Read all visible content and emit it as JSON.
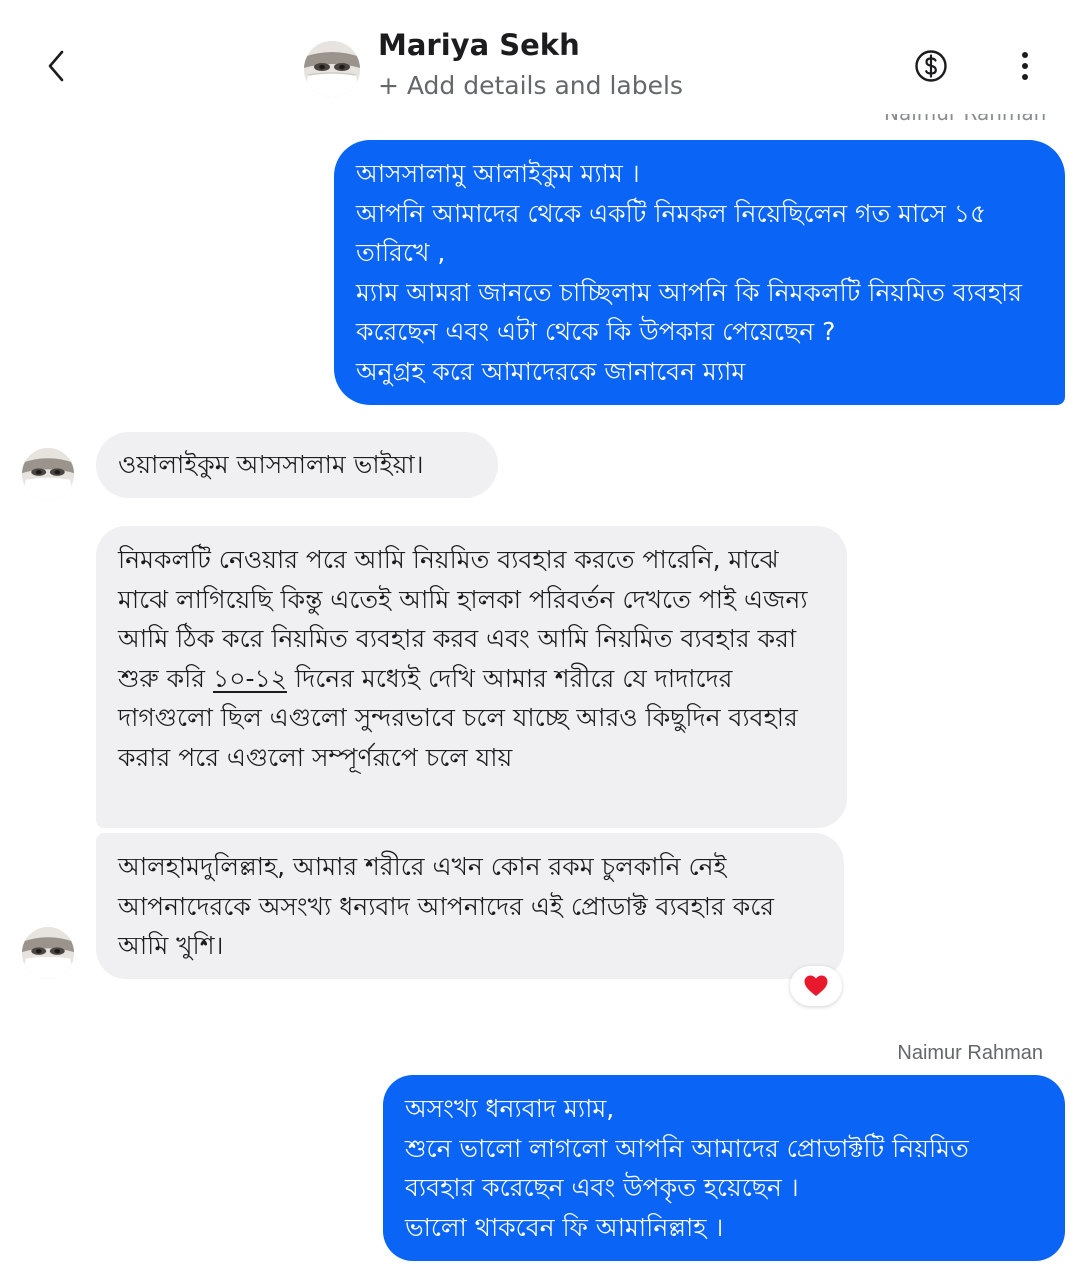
{
  "header": {
    "contact_name": "Mariya Sekh",
    "add_details": "+ Add details and labels",
    "icons": [
      "chevron-left-icon",
      "dollar-circle-icon",
      "more-vertical-icon"
    ]
  },
  "thread": {
    "clipped_sender": "Naimur Rahman",
    "messages": [
      {
        "direction": "outgoing",
        "text": "আসসালামু আলাইকুম ম্যাম ।\nআপনি আমাদের থেকে একটি নিমকল নিয়েছিলেন  গত মাসে ১৫ তারিখে ,\nম্যাম আমরা জানতে চাচ্ছিলাম আপনি কি নিমকলটি নিয়মিত ব্যবহার করেছেন এবং এটা থেকে কি উপকার পেয়েছেন ?\nঅনুগ্রহ করে আমাদেরকে জানাবেন ম্যাম"
      },
      {
        "direction": "incoming",
        "text": "ওয়ালাইকুম আসসালাম ভাইয়া।"
      },
      {
        "direction": "incoming",
        "text_before": "নিমকলটি নেওয়ার পরে আমি নিয়মিত ব্যবহার করতে পারেনি, মাঝে মাঝে লাগিয়েছি কিন্তু এতেই আমি হালকা পরিবর্তন দেখতে পাই এজন্য আমি ঠিক করে নিয়মিত ব্যবহার করব এবং আমি নিয়মিত ব্যবহার করা শুরু করি ",
        "link": "১০-১২",
        "text_after": " দিনের মধ্যেই দেখি আমার শরীরে যে দাদাদের দাগগুলো ছিল এগুলো সুন্দরভাবে চলে যাচ্ছে আরও কিছুদিন ব্যবহার করার পরে এগুলো সম্পূর্ণরূপে চলে যায়"
      },
      {
        "direction": "incoming",
        "text": "আলহামদুলিল্লাহ, আমার শরীরে এখন কোন রকম চুলকানি নেই আপনাদেরকে অসংখ্য ধন্যবাদ আপনাদের এই প্রোডাক্ট ব্যবহার করে আমি খুশি।",
        "reaction": "heart"
      },
      {
        "direction": "outgoing",
        "sender": "Naimur Rahman",
        "text": "অসংখ্য ধন্যবাদ ম্যাম,\nশুনে ভালো লাগলো আপনি আমাদের প্রোডাক্টটি নিয়মিত ব্যবহার করেছেন এবং উপকৃত হয়েছেন ।\nভালো থাকবেন ফি আমানিল্লাহ ।"
      }
    ]
  },
  "colors": {
    "outgoing_bubble": "#0a64f5",
    "incoming_bubble": "#f0f0f2",
    "reaction_heart": "#e8192c"
  }
}
